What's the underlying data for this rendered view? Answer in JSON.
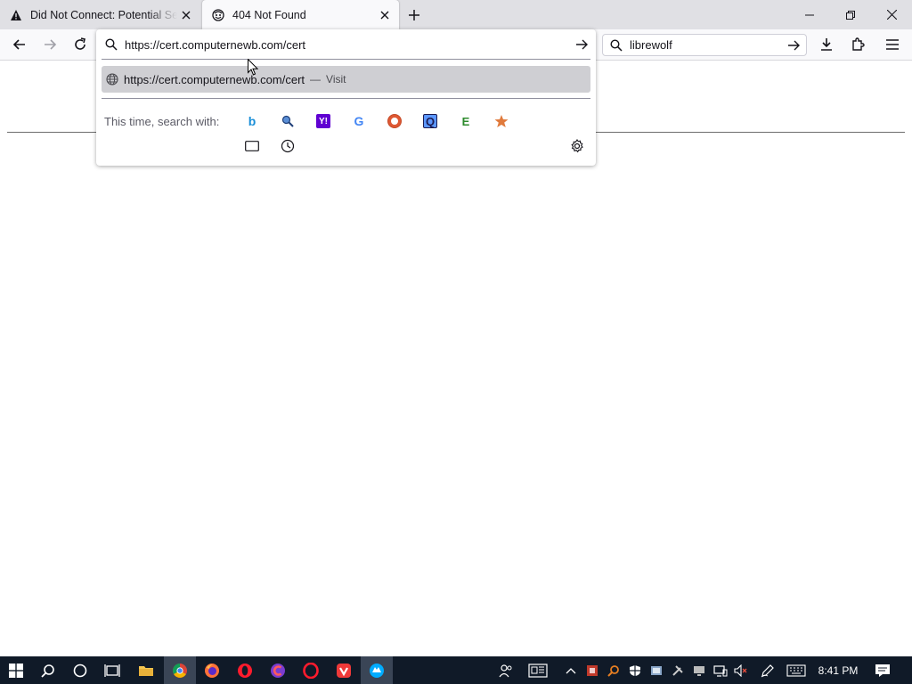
{
  "tabs": [
    {
      "title": "Did Not Connect: Potential Security Issue",
      "icon": "warning-icon",
      "active": false
    },
    {
      "title": "404 Not Found",
      "icon": "tab-favicon-icon",
      "active": true
    }
  ],
  "urlbar": {
    "value": "https://cert.computernewb.com/cert",
    "suggestion": {
      "url": "https://cert.computernewb.com/cert",
      "dash": "—",
      "action": "Visit"
    },
    "search_with_label": "This time, search with:",
    "engines": [
      {
        "name": "Bing",
        "icon": "bing-icon"
      },
      {
        "name": "Search",
        "icon": "magnifier-engine-icon"
      },
      {
        "name": "Yahoo",
        "icon": "yahoo-icon"
      },
      {
        "name": "Google",
        "icon": "google-icon"
      },
      {
        "name": "DuckDuckGo",
        "icon": "duckduckgo-icon"
      },
      {
        "name": "Qwant",
        "icon": "qwant-icon"
      },
      {
        "name": "Ecosia",
        "icon": "ecosia-icon"
      },
      {
        "name": "Bookmarks",
        "icon": "star-icon"
      },
      {
        "name": "Tabs",
        "icon": "tabs-icon"
      },
      {
        "name": "History",
        "icon": "history-icon"
      }
    ]
  },
  "searchbar": {
    "value": "librewolf"
  },
  "taskbar": {
    "time": "8:41 PM"
  },
  "colors": {
    "tabstrip": "#e0e0e4",
    "toolbar": "#f9f9fb",
    "suggestion_highlight": "#cfcfd3",
    "taskbar": "#101a28"
  }
}
